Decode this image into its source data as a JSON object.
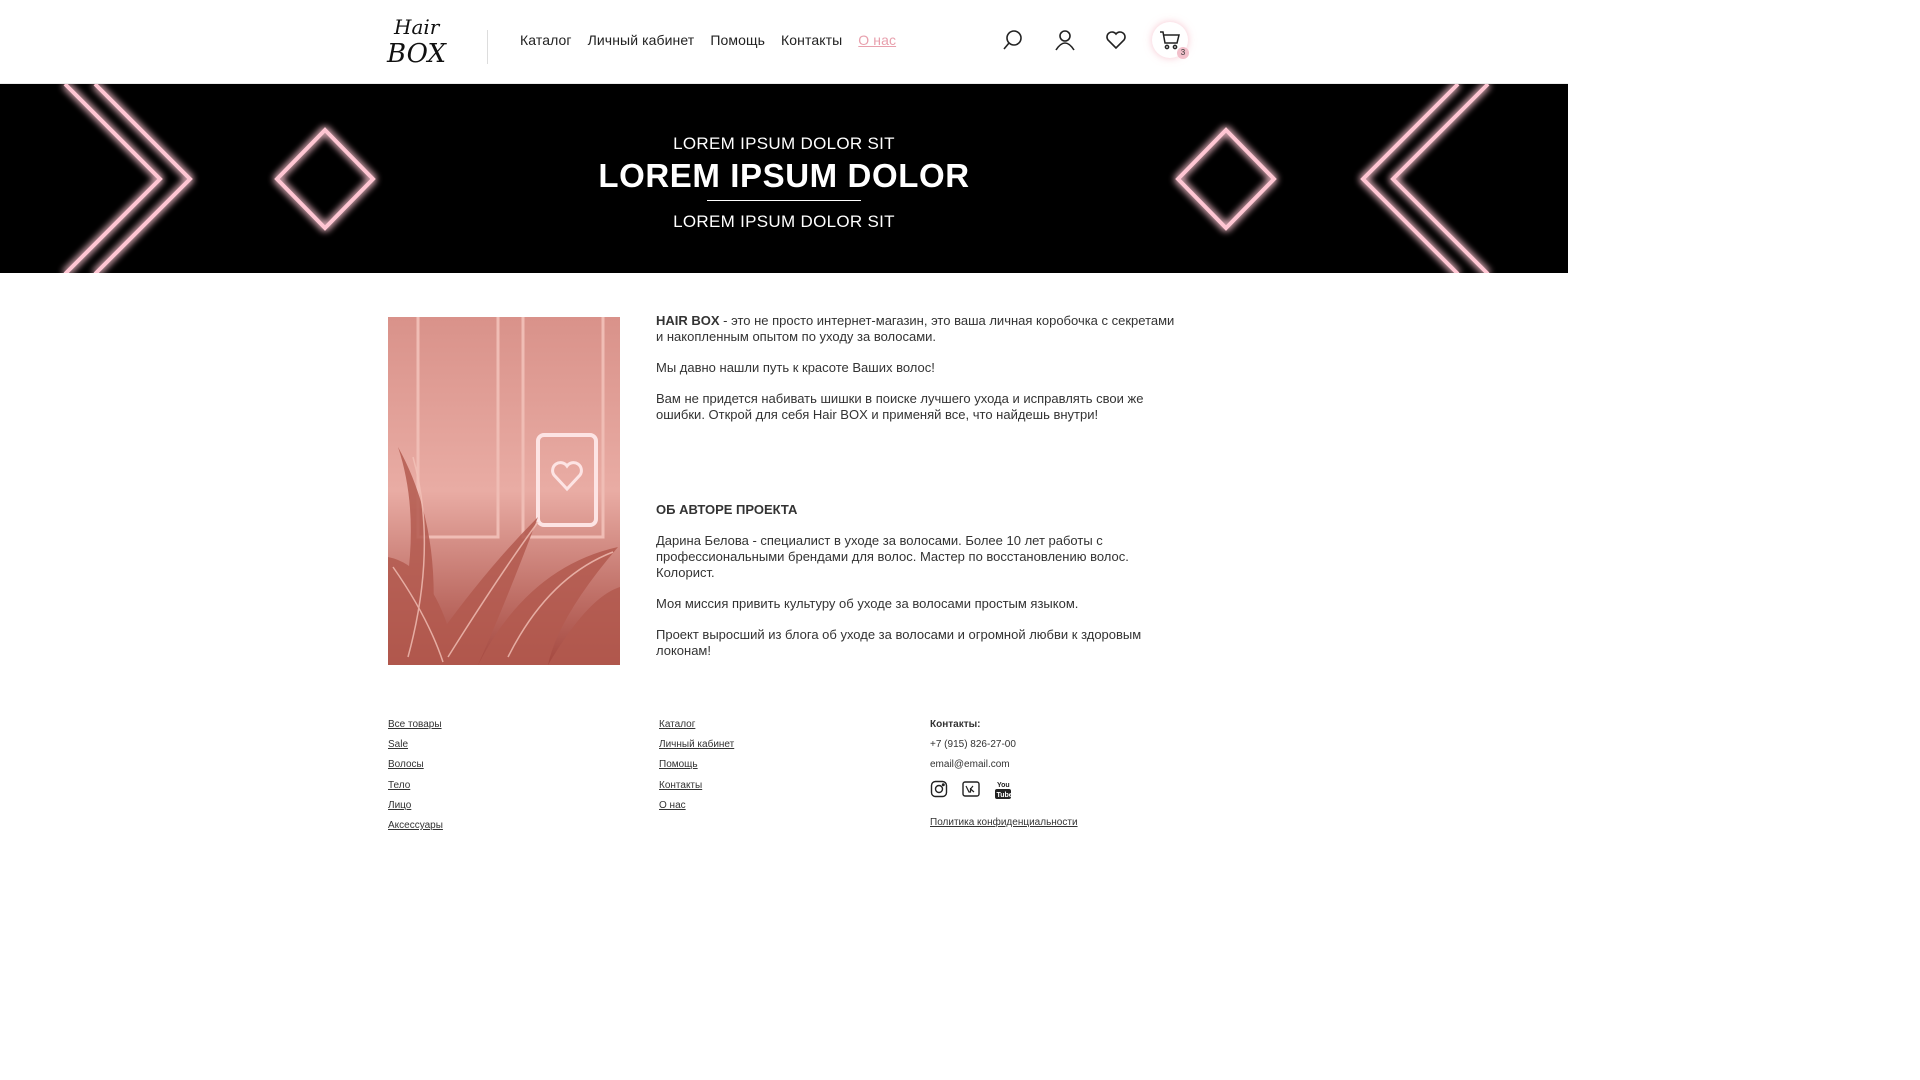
{
  "header": {
    "logo_top": "Hair",
    "logo_bottom": "BOX",
    "nav": [
      "Каталог",
      "Личный кабинет",
      "Помощь",
      "Контакты",
      "О нас"
    ],
    "active_nav": "О нас",
    "icons": [
      "search-icon",
      "user-icon",
      "heart-icon",
      "cart-icon"
    ],
    "cart_count": "3"
  },
  "banner": {
    "top": "LOREM IPSUM DOLOR SIT",
    "title": "LOREM IPSUM DOLOR",
    "bottom": "LOREM IPSUM DOLOR SIT"
  },
  "about": {
    "intro_brand": "HAIR BOX",
    "intro_rest": " - это не просто интернет-магазин, это ваша личная коробочка с секретами и накопленным опытом по уходу за волосами.",
    "p2": "Мы давно нашли путь к красоте Ваших волос!",
    "p3": "Вам не придется набивать шишки в поиске лучшего ухода и исправлять свои же ошибки. Открой для себя Hair BOX и применяй все, что найдешь внутри!",
    "author_heading": "ОБ АВТОРЕ ПРОЕКТА",
    "author_p1": "Дарина Белова - специалист в уходе за волосами. Более 10 лет работы с профессиональными брендами для волос. Мастер по восстановлению волос. Колорист.",
    "author_p2": "Моя миссия привить культуру об уходе за волосами простым языком.",
    "author_p3": "Проект выросший из блога об уходе за волосами и огромной любви к здоровым локонам!"
  },
  "footer": {
    "col1": [
      "Все товары",
      "Sale",
      "Волосы",
      "Тело",
      "Лицо",
      "Аксессуары"
    ],
    "col2": [
      "Каталог",
      "Личный кабинет",
      "Помощь",
      "Контакты",
      "О нас"
    ],
    "contacts_title": "Контакты:",
    "phone": "+7 (915) 826-27-00",
    "email": "email@email.com",
    "social": [
      "instagram-icon",
      "vk-icon",
      "youtube-icon"
    ],
    "youtube_label": "You Tube",
    "policy": "Политика конфиденциальности"
  },
  "colors": {
    "accent": "#e8a0ad",
    "neon": "#ffb8c8",
    "banner_bg": "#000000"
  }
}
